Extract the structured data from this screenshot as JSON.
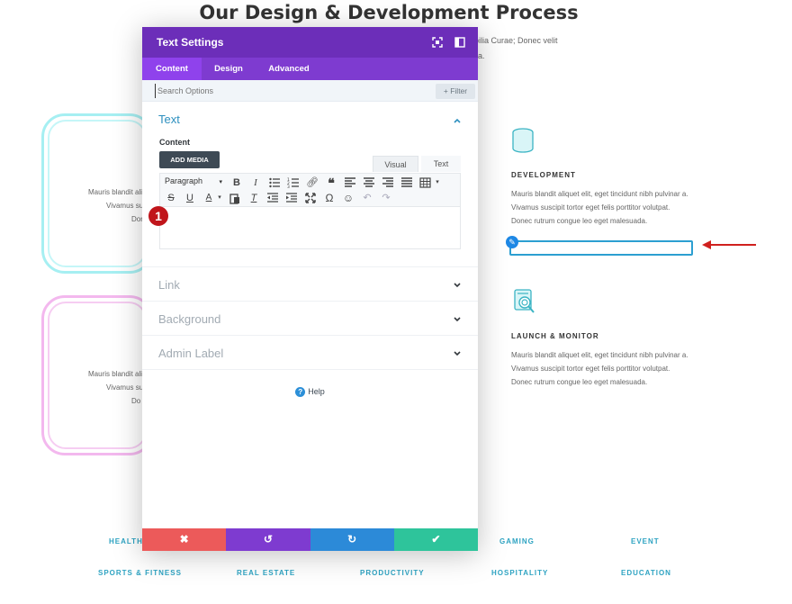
{
  "page": {
    "title": "Our Design & Development Process",
    "intro_line1": "e cubilia Curae; Donec velit",
    "intro_line2": "t ligula.",
    "cyan_frag": [
      "Mauris blandit ali",
      "Vivamus su",
      "Dor"
    ],
    "pink_frag": [
      "Mauris blandit ali",
      "Vivamus su",
      "Do"
    ]
  },
  "services": [
    {
      "title": "DEVELOPMENT",
      "lines": [
        "Mauris blandit aliquet elit, eget tincidunt nibh pulvinar a.",
        "Vivamus suscipit tortor eget felis porttitor volutpat.",
        "Donec rutrum congue leo eget malesuada."
      ]
    },
    {
      "title": "LAUNCH & MONITOR",
      "lines": [
        "Mauris blandit aliquet elit, eget tincidunt nibh pulvinar a.",
        "Vivamus suscipit tortor eget felis porttitor volutpat.",
        "Donec rutrum congue leo eget malesuada."
      ]
    }
  ],
  "categories_row1": [
    "HEALTHC",
    "GAMING",
    "EVENT"
  ],
  "categories_row2": [
    "SPORTS & FITNESS",
    "REAL ESTATE",
    "PRODUCTIVITY",
    "HOSPITALITY",
    "EDUCATION"
  ],
  "modal": {
    "title": "Text Settings",
    "tabs": [
      "Content",
      "Design",
      "Advanced"
    ],
    "search_placeholder": "Search Options",
    "filter_label": "Filter",
    "sections": {
      "text": "Text",
      "link": "Link",
      "background": "Background",
      "admin_label": "Admin Label"
    },
    "content_label": "Content",
    "add_media": "ADD MEDIA",
    "editor_tabs": [
      "Visual",
      "Text"
    ],
    "paragraph_select": "Paragraph",
    "help": "Help",
    "badge": "1"
  },
  "colors": {
    "header": "#6c2eb9",
    "tabs": "#7e3bd0",
    "cancel": "#ec5a5a",
    "undo": "#7e3bd0",
    "redo": "#2c8ad8",
    "save": "#2ec49b",
    "accent_text": "#2c8fbf"
  },
  "icons": {
    "expand": "fullscreen-icon",
    "sidebar": "sidebar-toggle-icon",
    "close": "close-icon",
    "undo": "undo-icon",
    "redo": "redo-icon",
    "save": "check-icon"
  }
}
